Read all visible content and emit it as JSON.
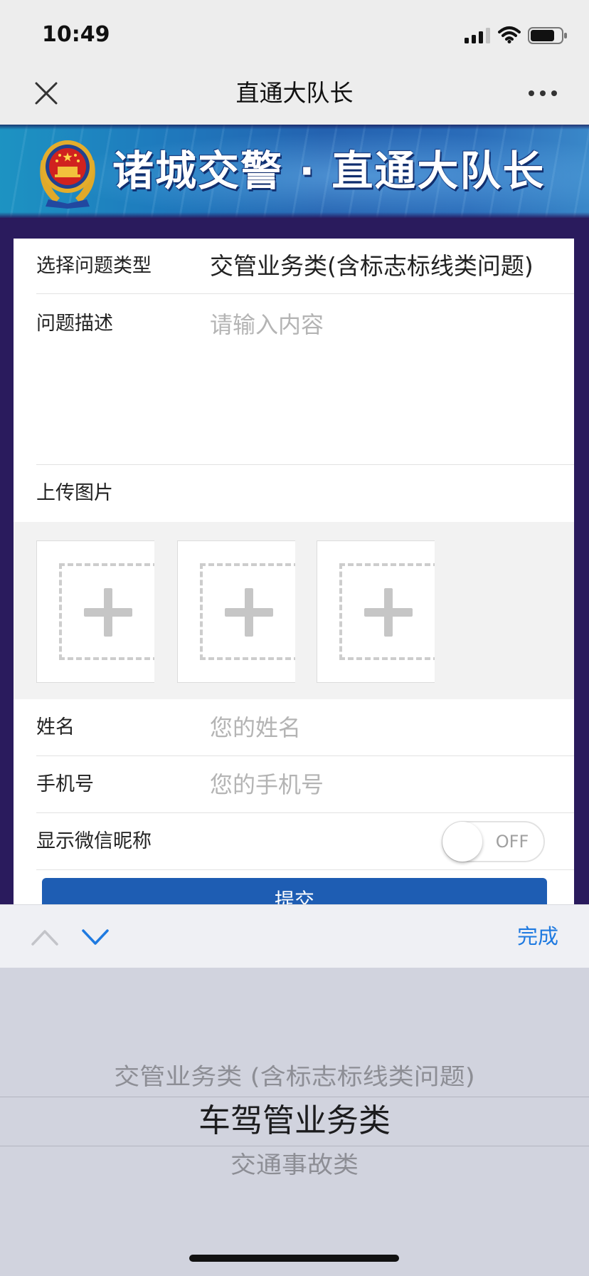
{
  "status_bar": {
    "time": "10:49",
    "icons": [
      "signal-icon",
      "wifi-icon",
      "battery-icon"
    ]
  },
  "nav": {
    "title": "直通大队长",
    "left_icon": "close-icon",
    "right_icon": "more-icon"
  },
  "banner": {
    "text": "诸城交警 · 直通大队长",
    "emblem_icon": "police-emblem-icon"
  },
  "form": {
    "issue_type": {
      "label": "选择问题类型",
      "value": "交管业务类(含标志标线类问题)"
    },
    "description": {
      "label": "问题描述",
      "placeholder": "请输入内容",
      "value": ""
    },
    "upload": {
      "label": "上传图片",
      "slots": [
        {
          "icon": "plus-icon"
        },
        {
          "icon": "plus-icon"
        },
        {
          "icon": "plus-icon"
        }
      ]
    },
    "name": {
      "label": "姓名",
      "placeholder": "您的姓名",
      "value": ""
    },
    "phone": {
      "label": "手机号",
      "placeholder": "您的手机号",
      "value": ""
    },
    "show_nickname": {
      "label": "显示微信昵称",
      "toggle_text": "OFF",
      "on": false
    },
    "submit_label": "提交"
  },
  "keyboard_toolbar": {
    "prev_icon": "chevron-up-icon",
    "next_icon": "chevron-down-icon",
    "done_label": "完成"
  },
  "picker": {
    "options": [
      "交管业务类 (含标志标线类问题)",
      "车驾管业务类",
      "交通事故类"
    ],
    "selected_index": 1
  },
  "colors": {
    "brand_purple": "#2a1b5d",
    "submit_blue": "#1e5db3",
    "accent_blue": "#1f7ae0"
  }
}
